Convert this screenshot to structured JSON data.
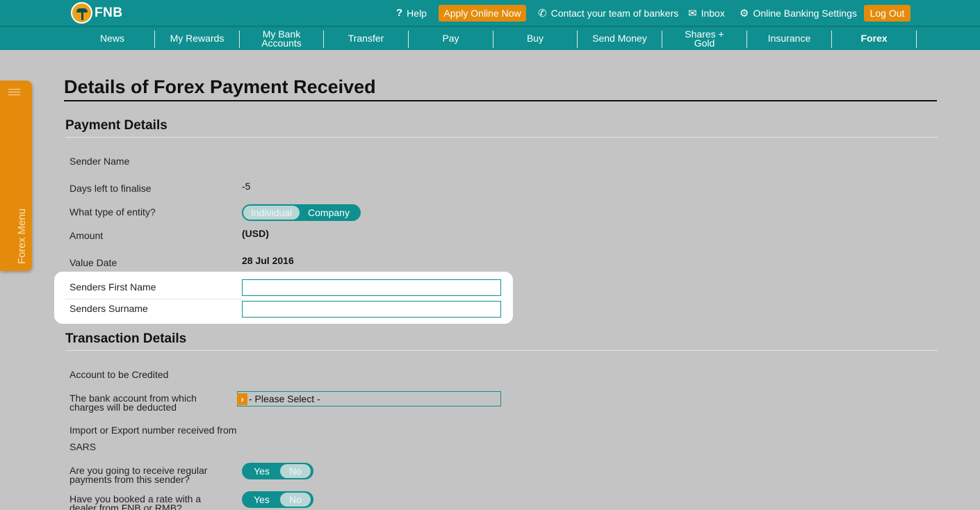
{
  "brand": {
    "name": "FNB"
  },
  "topbar": {
    "help": "Help",
    "apply_online": "Apply Online Now",
    "contact": "Contact your team of bankers",
    "inbox": "Inbox",
    "settings": "Online Banking Settings",
    "logout": "Log Out"
  },
  "nav": {
    "items": [
      {
        "label": "News"
      },
      {
        "label": "My Rewards"
      },
      {
        "label": "My Bank\nAccounts"
      },
      {
        "label": "Transfer"
      },
      {
        "label": "Pay"
      },
      {
        "label": "Buy"
      },
      {
        "label": "Send Money"
      },
      {
        "label": "Shares +\nGold"
      },
      {
        "label": "Insurance"
      },
      {
        "label": "Forex"
      }
    ],
    "active": "Forex"
  },
  "side_menu": {
    "label": "Forex Menu"
  },
  "page": {
    "title": "Details of Forex Payment Received"
  },
  "payment_details": {
    "title": "Payment Details",
    "sender_name_label": "Sender Name",
    "days_left_label": "Days left to finalise",
    "days_left_value": "-5",
    "entity_label": "What type of entity?",
    "entity_options": [
      "Individual",
      "Company"
    ],
    "entity_selected": "Individual",
    "amount_label": "Amount",
    "amount_value": "(USD)",
    "value_date_label": "Value Date",
    "value_date_value": "28 Jul 2016",
    "first_name_label": "Senders First Name",
    "first_name_value": "",
    "surname_label": "Senders Surname",
    "surname_value": ""
  },
  "transaction_details": {
    "title": "Transaction Details",
    "account_credited_label": "Account to be Credited",
    "charges_account_label": "The bank account from which charges will be deducted",
    "charges_account_value": "- Please Select -",
    "import_export_label": "Import or Export number received from",
    "sars_label": "SARS",
    "regular_payments_label": "Are you going to receive regular payments from this sender?",
    "regular_payments_options": [
      "Yes",
      "No"
    ],
    "regular_payments_selected": "No",
    "booked_rate_label": "Have you booked a rate with a dealer from FNB or RMB?",
    "booked_rate_options": [
      "Yes",
      "No"
    ],
    "booked_rate_selected": "No"
  },
  "colors": {
    "teal": "#0f8f8f",
    "orange": "#e58b0b",
    "background": "#c4c4c4"
  },
  "icons": [
    "help-icon",
    "phone-icon",
    "envelope-icon",
    "gear-icon",
    "hamburger-icon",
    "select-arrow-icon"
  ]
}
